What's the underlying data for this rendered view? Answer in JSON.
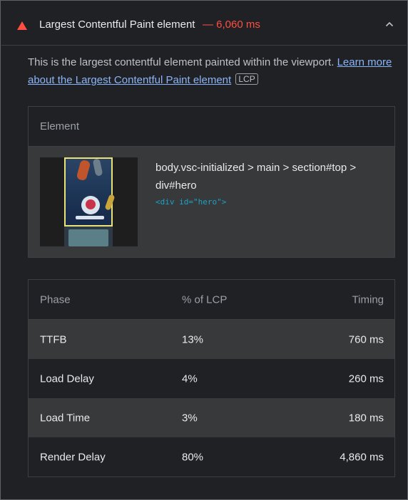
{
  "audit": {
    "title": "Largest Contentful Paint element",
    "value": "— 6,060 ms",
    "status_color": "#ff4e42",
    "status_icon": "fail-triangle-icon"
  },
  "description": {
    "text": "This is the largest contentful element painted within the viewport. ",
    "link_text": "Learn more about the Largest Contentful Paint element",
    "tag": "LCP"
  },
  "element_table": {
    "header": "Element",
    "selector": "body.vsc-initialized > main > section#top > div#hero",
    "snippet": "<div id=\"hero\">"
  },
  "phase_table": {
    "headers": {
      "phase": "Phase",
      "pct": "% of LCP",
      "timing": "Timing"
    },
    "rows": [
      {
        "phase": "TTFB",
        "pct": "13%",
        "timing": "760 ms"
      },
      {
        "phase": "Load Delay",
        "pct": "4%",
        "timing": "260 ms"
      },
      {
        "phase": "Load Time",
        "pct": "3%",
        "timing": "180 ms"
      },
      {
        "phase": "Render Delay",
        "pct": "80%",
        "timing": "4,860 ms"
      }
    ]
  }
}
